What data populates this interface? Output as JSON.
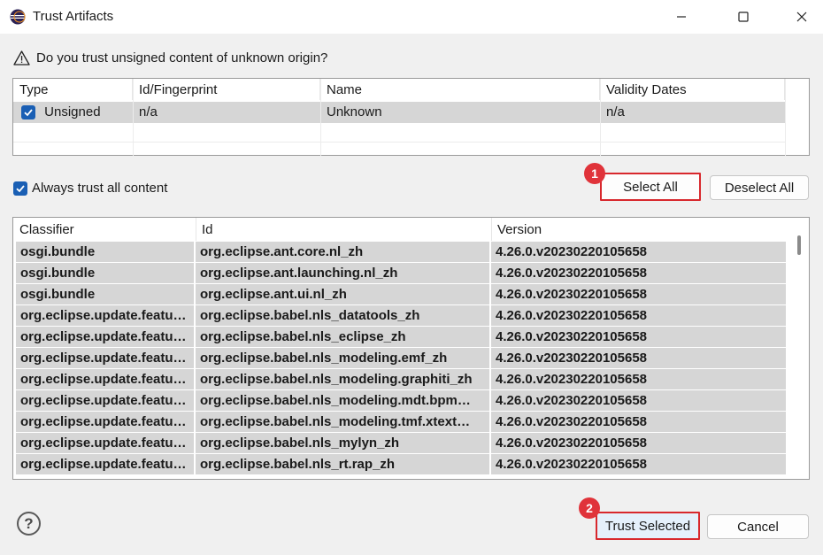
{
  "window": {
    "title": "Trust Artifacts",
    "minimize_icon": "minimize-icon",
    "maximize_icon": "maximize-icon",
    "close_icon": "close-icon"
  },
  "question": "Do you trust unsigned content of unknown origin?",
  "origin_table": {
    "headers": [
      "Type",
      "Id/Fingerprint",
      "Name",
      "Validity Dates"
    ],
    "rows": [
      {
        "checked": true,
        "type": "Unsigned",
        "id": "n/a",
        "name": "Unknown",
        "validity": "n/a"
      }
    ]
  },
  "always_trust": {
    "checked": true,
    "label": "Always trust all content"
  },
  "buttons": {
    "select_all": "Select All",
    "deselect_all": "Deselect All",
    "trust_selected": "Trust Selected",
    "cancel": "Cancel"
  },
  "annotations": {
    "badge_1": "1",
    "badge_2": "2"
  },
  "artifacts_table": {
    "headers": [
      "Classifier",
      "Id",
      "Version"
    ],
    "rows": [
      {
        "classifier": "osgi.bundle",
        "id": "org.eclipse.ant.core.nl_zh",
        "version": "4.26.0.v20230220105658"
      },
      {
        "classifier": "osgi.bundle",
        "id": "org.eclipse.ant.launching.nl_zh",
        "version": "4.26.0.v20230220105658"
      },
      {
        "classifier": "osgi.bundle",
        "id": "org.eclipse.ant.ui.nl_zh",
        "version": "4.26.0.v20230220105658"
      },
      {
        "classifier": "org.eclipse.update.featu…",
        "id": "org.eclipse.babel.nls_datatools_zh",
        "version": "4.26.0.v20230220105658"
      },
      {
        "classifier": "org.eclipse.update.featu…",
        "id": "org.eclipse.babel.nls_eclipse_zh",
        "version": "4.26.0.v20230220105658"
      },
      {
        "classifier": "org.eclipse.update.featu…",
        "id": "org.eclipse.babel.nls_modeling.emf_zh",
        "version": "4.26.0.v20230220105658"
      },
      {
        "classifier": "org.eclipse.update.featu…",
        "id": "org.eclipse.babel.nls_modeling.graphiti_zh",
        "version": "4.26.0.v20230220105658"
      },
      {
        "classifier": "org.eclipse.update.featu…",
        "id": "org.eclipse.babel.nls_modeling.mdt.bpm…",
        "version": "4.26.0.v20230220105658"
      },
      {
        "classifier": "org.eclipse.update.featu…",
        "id": "org.eclipse.babel.nls_modeling.tmf.xtext…",
        "version": "4.26.0.v20230220105658"
      },
      {
        "classifier": "org.eclipse.update.featu…",
        "id": "org.eclipse.babel.nls_mylyn_zh",
        "version": "4.26.0.v20230220105658"
      },
      {
        "classifier": "org.eclipse.update.featu…",
        "id": "org.eclipse.babel.nls_rt.rap_zh",
        "version": "4.26.0.v20230220105658"
      }
    ]
  },
  "help_icon": "help-icon",
  "help_glyph": "?",
  "colors": {
    "accent": "#1a5fb4",
    "highlight": "#d8282d",
    "badge": "#e0333a",
    "row_selected": "#d6d6d6"
  }
}
